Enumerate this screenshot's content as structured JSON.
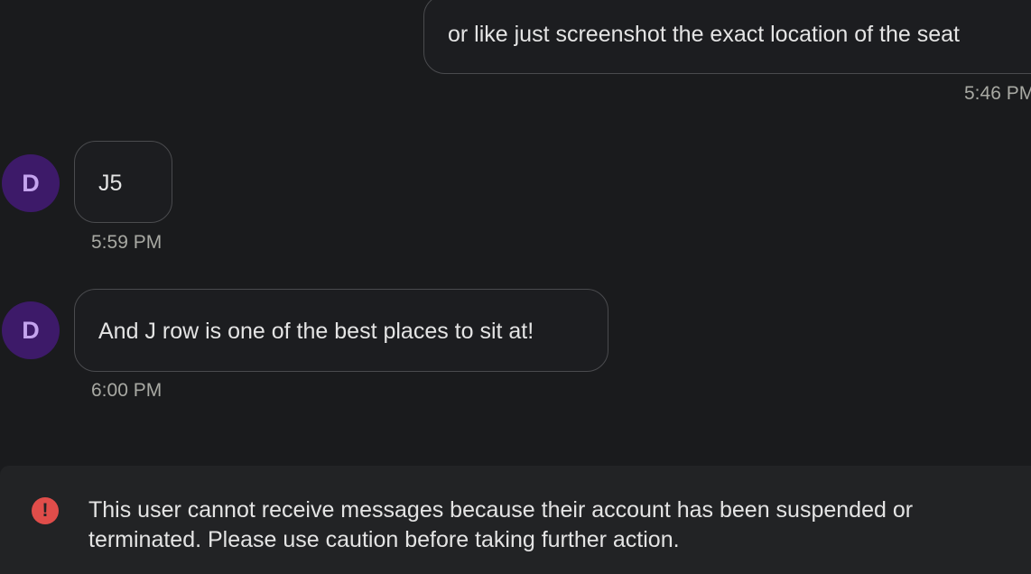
{
  "messages": [
    {
      "sender": "me",
      "text": "or like just screenshot the exact location of the seat",
      "time": "5:46 PM"
    },
    {
      "sender": "D",
      "avatar_letter": "D",
      "text": "J5",
      "time": "5:59 PM"
    },
    {
      "sender": "D",
      "avatar_letter": "D",
      "text": "And J row is one of the best places to sit at!",
      "time": "6:00 PM"
    }
  ],
  "notice": {
    "icon": "exclamation-circle-icon",
    "text": "This user cannot receive messages because their account has been suspended or terminated. Please use caution before taking further action."
  },
  "colors": {
    "background": "#1a1b1d",
    "bubble_border": "#4a4b4e",
    "avatar_bg": "#3d1a69",
    "avatar_text": "#c4a4ee",
    "timestamp": "#a8a9a3",
    "notice_bg": "#222325",
    "warning_red": "#e04d4a"
  }
}
